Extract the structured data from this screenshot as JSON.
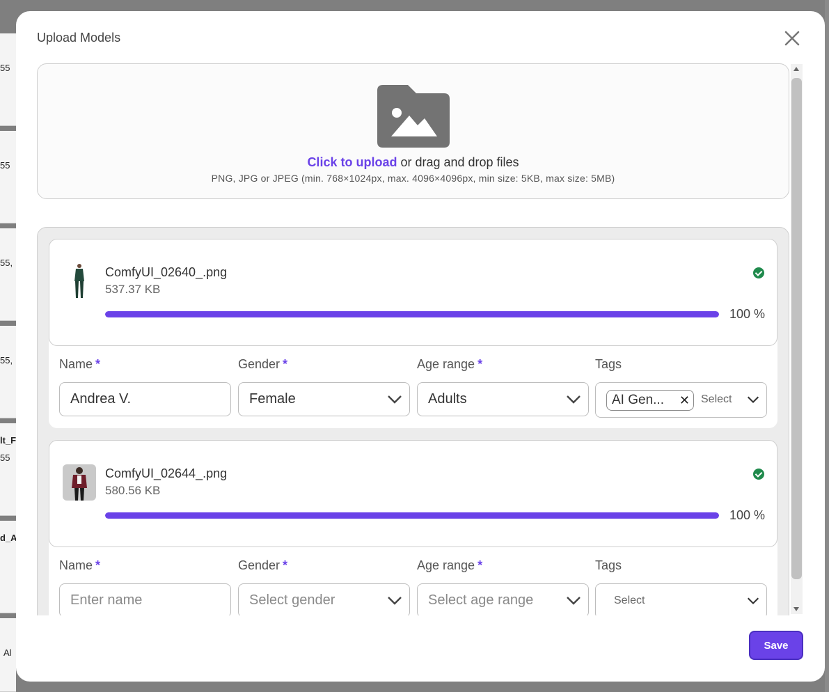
{
  "background": {
    "snippets": [
      "55",
      "55",
      "55, ",
      "55, ",
      "lt_F",
      "55",
      "d_A",
      "Al"
    ]
  },
  "modal": {
    "title": "Upload Models",
    "close_icon": "close-icon"
  },
  "dropzone": {
    "icon": "image-folder-icon",
    "link_text": "Click to upload",
    "rest_text": " or drag and drop files",
    "hint": "PNG, JPG or JPEG (min. 768×1024px, max. 4096×4096px, min size: 5KB, max size: 5MB)"
  },
  "files": [
    {
      "name": "ComfyUI_02640_.png",
      "size": "537.37 KB",
      "progress_pct": "100 %",
      "progress_value": 100,
      "status_icon": "check-circle-icon",
      "fields": {
        "name_label": "Name",
        "gender_label": "Gender",
        "age_label": "Age range",
        "tags_label": "Tags",
        "required_mark": "*",
        "name_value": "Andrea V.",
        "gender_value": "Female",
        "age_value": "Adults",
        "tag_chip": "AI Gen...",
        "tag_chip_remove": "✕",
        "tags_select": "Select"
      }
    },
    {
      "name": "ComfyUI_02644_.png",
      "size": "580.56 KB",
      "progress_pct": "100 %",
      "progress_value": 100,
      "status_icon": "check-circle-icon",
      "fields": {
        "name_label": "Name",
        "gender_label": "Gender",
        "age_label": "Age range",
        "tags_label": "Tags",
        "required_mark": "*",
        "name_placeholder": "Enter name",
        "gender_placeholder": "Select gender",
        "age_placeholder": "Select age range",
        "tags_select": "Select"
      }
    }
  ],
  "footer": {
    "save_label": "Save"
  },
  "colors": {
    "accent": "#6a42e8",
    "success": "#1f8a4c",
    "overlay": "#7f7f7f"
  }
}
